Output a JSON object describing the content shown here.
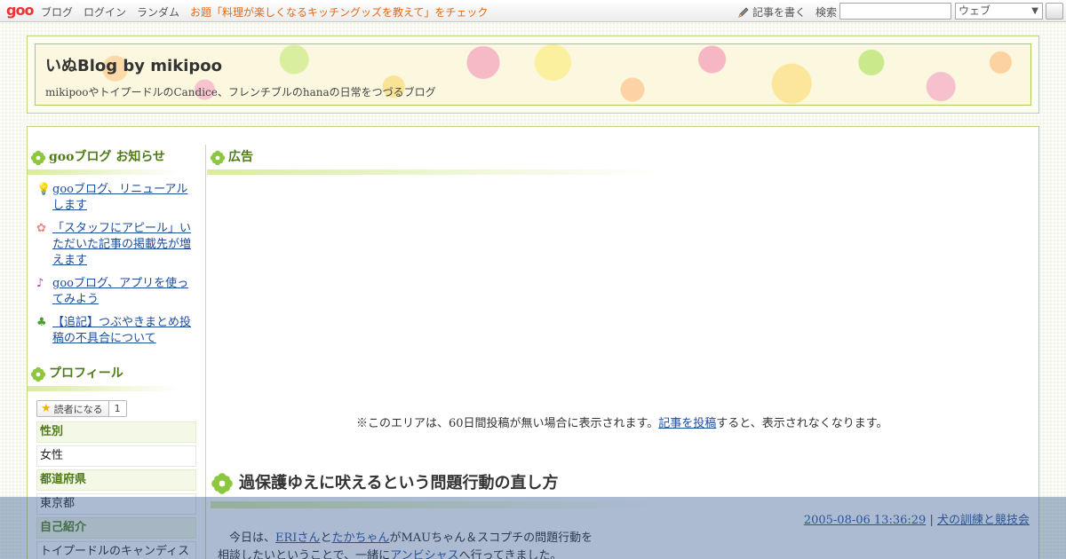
{
  "toolbar": {
    "logo": "goo",
    "nav": [
      "ブログ",
      "ログイン",
      "ランダム"
    ],
    "promo": "お題「料理が楽しくなるキッチングッズを教えて」をチェック",
    "write_label": "記事を書く",
    "search_label": "検索",
    "search_value": "",
    "search_scope": "ウェブ"
  },
  "header": {
    "title": "いぬBlog by mikipoo",
    "description": "mikipooやトイプードルのCandice、フレンチブルのhanaの日常をつづるブログ"
  },
  "sidebar": {
    "notices_title": "gooブログ お知らせ",
    "notices": [
      {
        "icon": "lightbulb-icon",
        "bullet": "💡",
        "text": "gooブログ、リニューアルします"
      },
      {
        "icon": "flower-icon",
        "bullet": "✿",
        "text": "「スタッフにアピール」いただいた記事の掲載先が増えます"
      },
      {
        "icon": "music-note-icon",
        "bullet": "♪",
        "text": "gooブログ、アプリを使ってみよう"
      },
      {
        "icon": "clover-icon",
        "bullet": "♣",
        "text": "【追記】つぶやきまとめ投稿の不具合について"
      }
    ],
    "profile_title": "プロフィール",
    "reader_label": "読者になる",
    "reader_count": "1",
    "profile": {
      "gender_label": "性別",
      "gender_value": "女性",
      "pref_label": "都道府県",
      "pref_value": "東京都",
      "intro_label": "自己紹介",
      "intro_value": "トイプードルのキャンディス"
    }
  },
  "content": {
    "ad_title": "広告",
    "ad_note_pre": "※このエリアは、60日間投稿が無い場合に表示されます。",
    "ad_note_link": "記事を投稿",
    "ad_note_post": "すると、表示されなくなります。",
    "entry": {
      "title": "過保護ゆえに吠えるという問題行動の直し方",
      "datetime": "2005-08-06 13:36:29",
      "separator": "|",
      "category": "犬の訓練と競技会",
      "body_line1_pre": "今日は、",
      "link_eri": "ERIさん",
      "and": "と",
      "link_taka": "たかちゃん",
      "body_line1_post": "がMAUちゃん＆スコプチの問題行動を",
      "body_line2_pre": "相談したいということで、一緒に",
      "link_anvi": "アンビシャス",
      "body_line2_post": "へ行ってきました。"
    }
  }
}
